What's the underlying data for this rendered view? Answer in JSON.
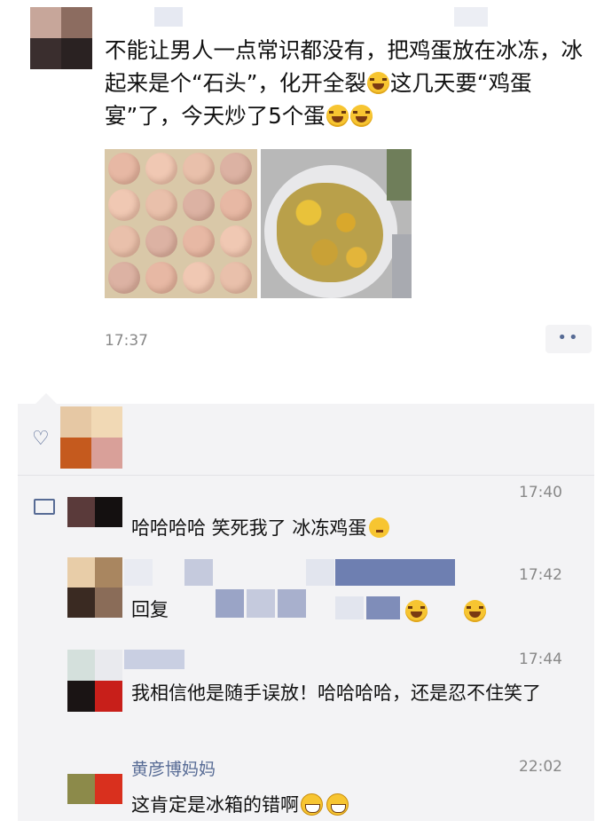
{
  "post": {
    "text": "不能让男人一点常识都没有，把鸡蛋放在冰冻，冰起来是个“石头”，化开全裂",
    "text_cont": "这几天要“鸡蛋宴”了，今天炒了5个蛋",
    "time": "17:37",
    "more_label": "••"
  },
  "comments": [
    {
      "name": "",
      "time": "17:40",
      "text": "哈哈哈哈 笑死我了 冰冻鸡蛋"
    },
    {
      "name": "",
      "time": "17:42",
      "text": "回复"
    },
    {
      "name": "",
      "time": "17:44",
      "text": "我相信他是随手误放！哈哈哈哈，还是忍不住笑了"
    },
    {
      "name": "黄彦博妈妈",
      "time": "22:02",
      "text": "这肯定是冰箱的错啊"
    }
  ],
  "icons": {
    "like": "heart-outline-icon",
    "comment": "comment-icon",
    "emoji_laugh": "crying-laughing-emoji-icon",
    "emoji_think": "thinking-emoji-icon",
    "emoji_grin": "grinning-emoji-icon"
  },
  "colors": {
    "name_link": "#576b95",
    "comment_bg": "#f3f3f5",
    "time_gray": "#888888"
  }
}
